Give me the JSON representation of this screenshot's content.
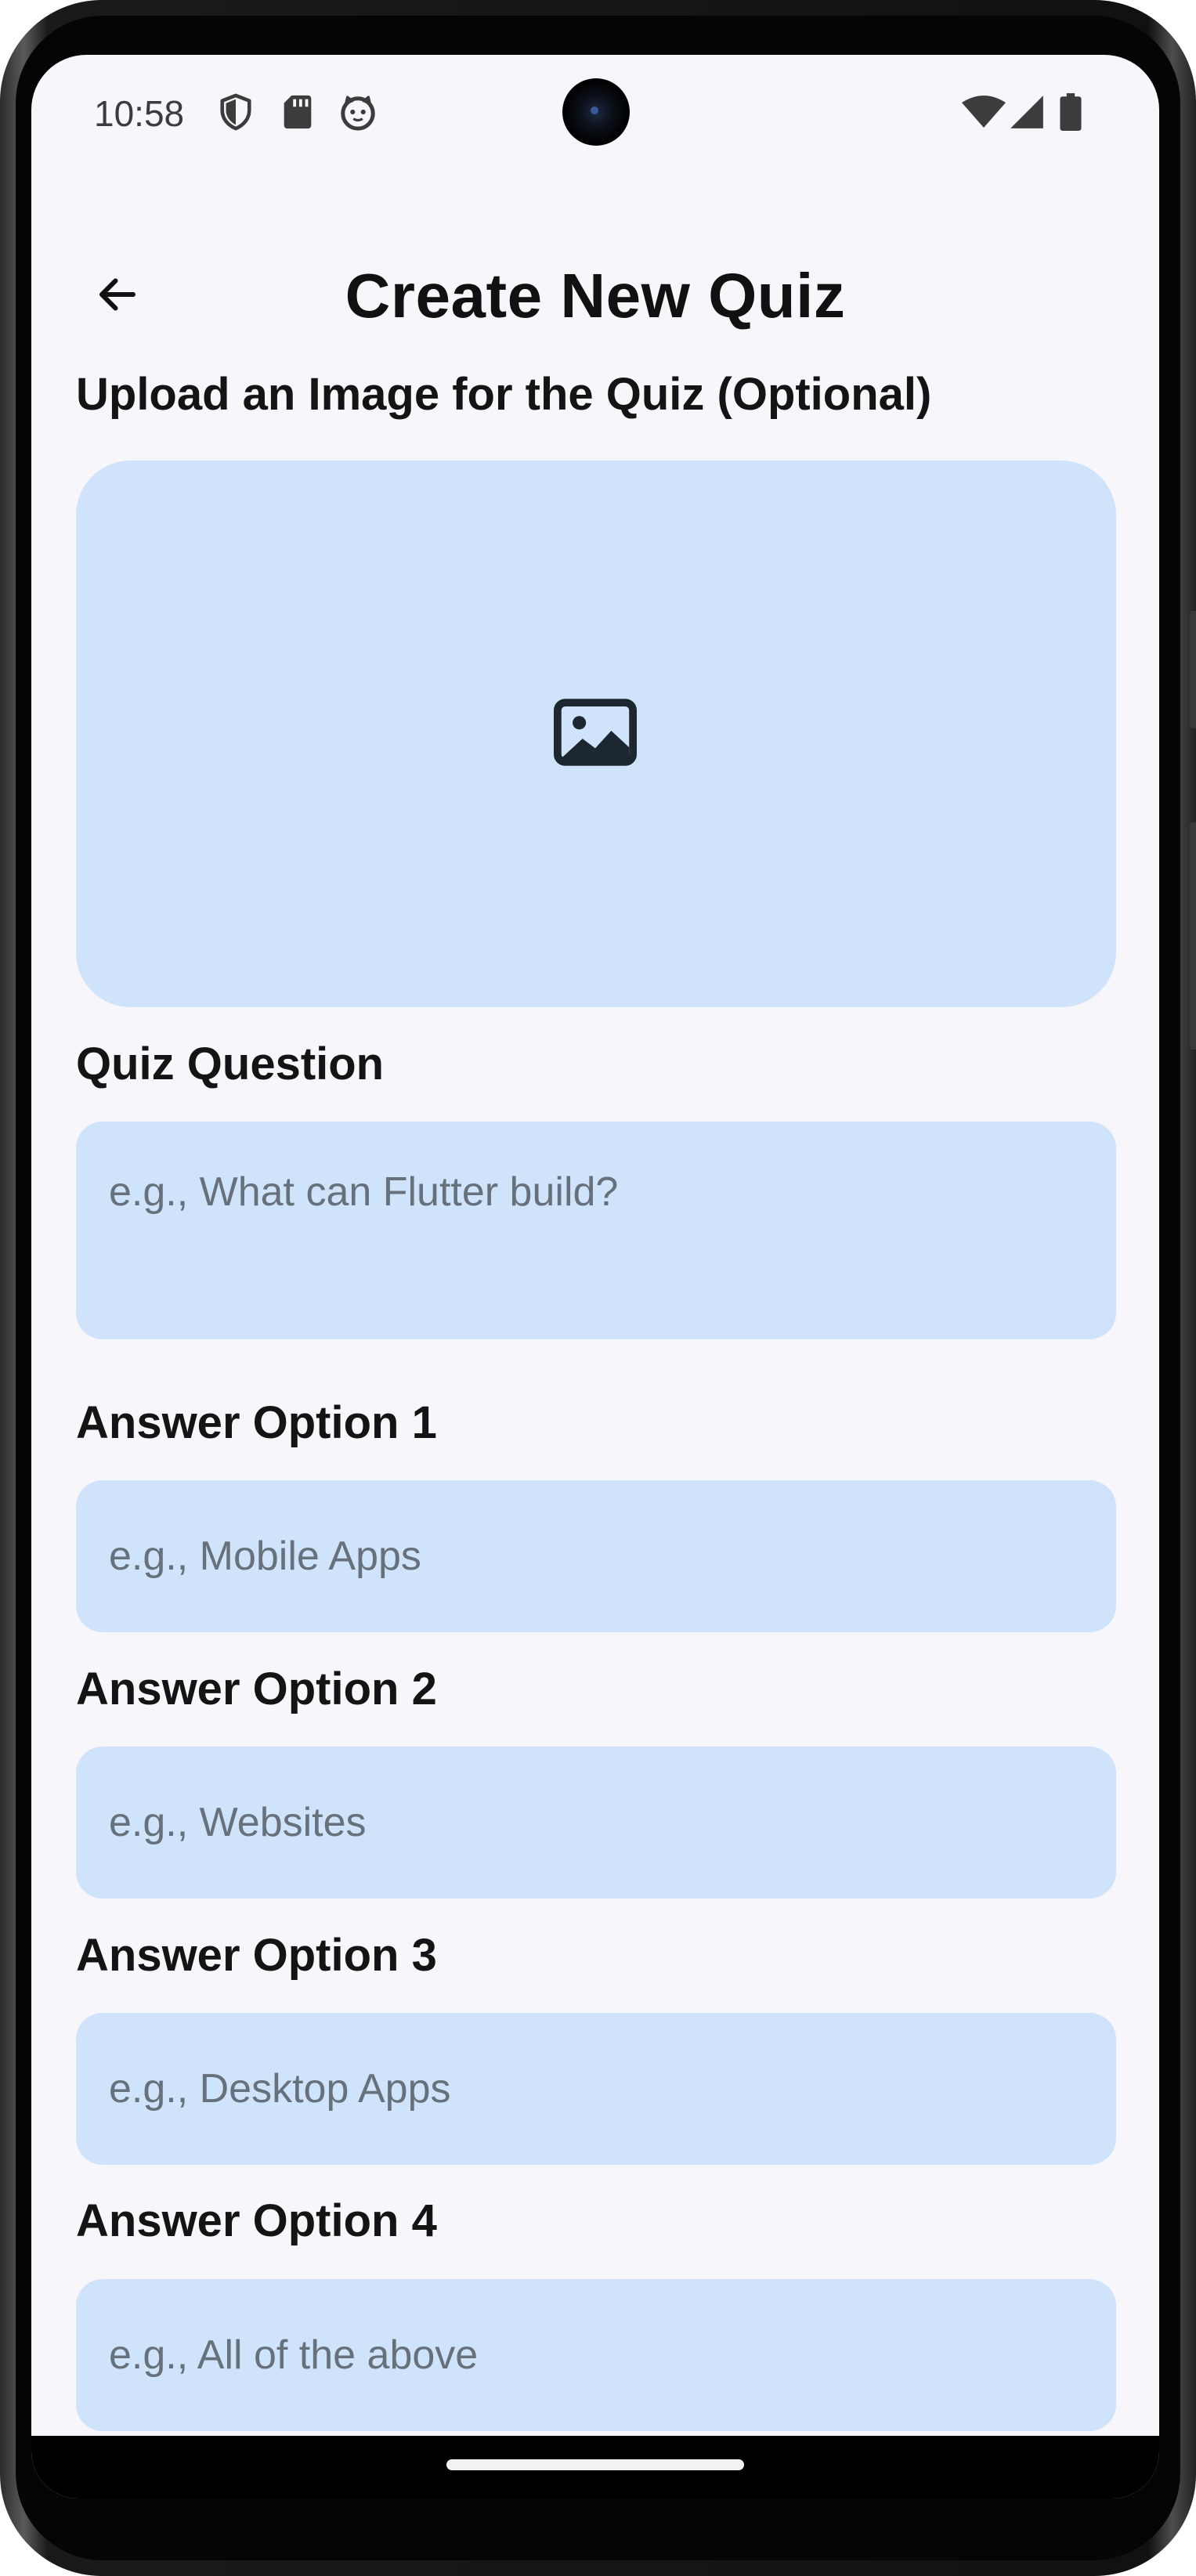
{
  "status_bar": {
    "time": "10:58",
    "left_icons": [
      "shield-icon",
      "sd-card-icon",
      "cat-face-icon"
    ],
    "right_icons": [
      "wifi-icon",
      "cellular-signal-icon",
      "battery-icon"
    ]
  },
  "app_bar": {
    "back_icon": "arrow-back-icon",
    "title": "Create New Quiz"
  },
  "upload": {
    "label": "Upload an Image for the Quiz (Optional)",
    "icon": "image-icon"
  },
  "question": {
    "label": "Quiz Question",
    "placeholder": "e.g., What can Flutter build?",
    "value": ""
  },
  "options": [
    {
      "label": "Answer Option 1",
      "placeholder": "e.g., Mobile Apps",
      "value": ""
    },
    {
      "label": "Answer Option 2",
      "placeholder": "e.g., Websites",
      "value": ""
    },
    {
      "label": "Answer Option 3",
      "placeholder": "e.g., Desktop Apps",
      "value": ""
    },
    {
      "label": "Answer Option 4",
      "placeholder": "e.g., All of the above",
      "value": ""
    }
  ],
  "colors": {
    "background": "#f6f6fb",
    "field_fill": "#cfe3fa",
    "placeholder": "#67717c",
    "title": "#111111"
  }
}
